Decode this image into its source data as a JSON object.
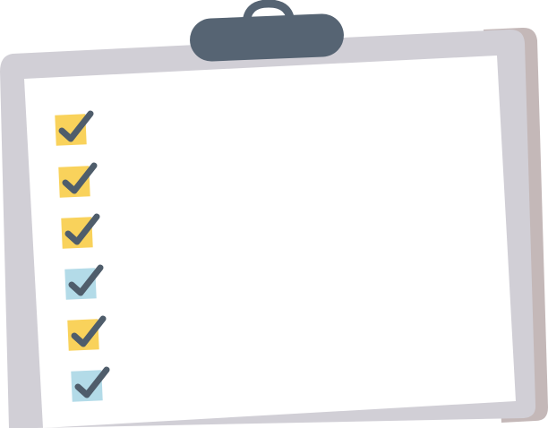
{
  "colors": {
    "board": "#d1cfd6",
    "board_shadow": "#c4b8b8",
    "paper": "#ffffff",
    "clip": "#566473",
    "check": "#4f5d6b",
    "box_yellow": "#f9d25b",
    "box_blue": "#b3dbe8"
  },
  "checklist": {
    "items": [
      {
        "box_color": "yellow",
        "checked": true
      },
      {
        "box_color": "yellow",
        "checked": true
      },
      {
        "box_color": "yellow",
        "checked": true
      },
      {
        "box_color": "blue",
        "checked": true
      },
      {
        "box_color": "yellow",
        "checked": true
      },
      {
        "box_color": "blue",
        "checked": true
      }
    ]
  }
}
